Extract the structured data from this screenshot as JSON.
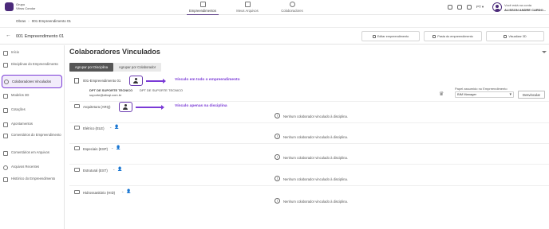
{
  "topbar": {
    "logo_line1": "Grupo",
    "logo_line2": "Vitrus Condor",
    "tabs": [
      {
        "label": "Empreendimentos",
        "active": true
      },
      {
        "label": "Meus Arquivos",
        "active": false
      },
      {
        "label": "Colaboradores",
        "active": false
      }
    ],
    "language": "PT",
    "user_prompt": "Você está na conta",
    "user_name": "ALISSON ANDRE CARDO..."
  },
  "breadcrumb": {
    "items": [
      "Obras",
      "001 Empreendimento 01"
    ]
  },
  "header": {
    "back_icon": "arrow-left-icon",
    "title": "001 Empreendimento 01",
    "buttons": [
      "Editar empreendimento",
      "Pasta do empreendimento",
      "Visualizar 3D"
    ]
  },
  "sidebar": {
    "items": [
      {
        "label": "Início",
        "icon": "home-icon",
        "active": false
      },
      {
        "label": "Disciplinas do Empreendimento",
        "icon": "document-icon",
        "active": false
      },
      {
        "label": "Colaboradores Vinculados",
        "icon": "user-icon",
        "active": true
      },
      {
        "label": "Modelos 3D",
        "icon": "cube-icon",
        "active": false
      },
      {
        "label": "Cotações",
        "icon": "tag-icon",
        "active": false
      },
      {
        "label": "Apontamentos",
        "icon": "note-icon",
        "active": false
      },
      {
        "label": "Comentários do Empreendimento",
        "icon": "comment-icon",
        "active": false
      },
      {
        "label": "Comentários em Arquivos",
        "icon": "comment-file-icon",
        "active": false
      },
      {
        "label": "Arquivos Recentes",
        "icon": "clock-icon",
        "active": false
      },
      {
        "label": "Histórico do Empreendimento",
        "icon": "history-icon",
        "active": false
      }
    ]
  },
  "main": {
    "title": "Colaboradores Vinculados",
    "tabs": [
      {
        "label": "Agrupar por Disciplina",
        "active": true
      },
      {
        "label": "Agrupar por Colaborador",
        "active": false
      }
    ],
    "project_row": {
      "label": "001-Empreendimento 01",
      "annotation": "Vínculo em todo o empreendimento",
      "collaborator_name": "DPT DE SUPORTE TECNICO",
      "collaborator_email": "suporte@altoqi.com.br",
      "collaborator_company": "DPT DE SUPORTE TECNICO",
      "role_label": "Papel assumido no Empreendimento",
      "role_value": "BIM Manager",
      "unlink_button": "Desvincular"
    },
    "disciplines": [
      {
        "label": "Arquitetura (ARQ)",
        "annotation": "Vínculo apenas na disciplina",
        "empty": "Nenhum colaborador vinculado à disciplina."
      },
      {
        "label": "Elétrico (ELE)",
        "empty": "Nenhum colaborador vinculado à disciplina."
      },
      {
        "label": "Especiais (ESP)",
        "empty": "Nenhum colaborador vinculado à disciplina."
      },
      {
        "label": "Estrutural (EST)",
        "empty": "Nenhum colaborador vinculado à disciplina."
      },
      {
        "label": "Hidrossanitário (HID)",
        "empty": "Nenhum colaborador vinculado à disciplina."
      }
    ]
  }
}
